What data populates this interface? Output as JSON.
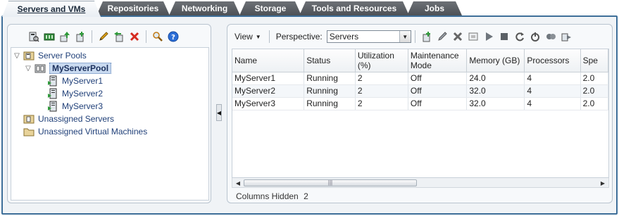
{
  "tabs": [
    {
      "label": "Servers and VMs",
      "active": true
    },
    {
      "label": "Repositories",
      "active": false
    },
    {
      "label": "Networking",
      "active": false
    },
    {
      "label": "Storage",
      "active": false
    },
    {
      "label": "Tools and Resources",
      "active": false
    },
    {
      "label": "Jobs",
      "active": false
    }
  ],
  "left_toolbar": {
    "icons": [
      "discover-server-icon",
      "create-server-pool-icon",
      "upload-icon",
      "add-server-icon",
      "edit-icon",
      "move-icon",
      "delete-icon",
      "find-icon",
      "help-icon"
    ]
  },
  "tree": {
    "server_pools": "Server Pools",
    "pool": "MyServerPool",
    "servers": [
      "MyServer1",
      "MyServer2",
      "MyServer3"
    ],
    "unassigned_servers": "Unassigned Servers",
    "unassigned_vms": "Unassigned Virtual Machines"
  },
  "right_toolbar": {
    "view_label": "View",
    "perspective_label": "Perspective:",
    "perspective_value": "Servers",
    "icons": [
      "add-icon",
      "edit-icon",
      "delete-icon",
      "console-icon",
      "start-icon",
      "stop-icon",
      "restart-icon",
      "power-icon",
      "kill-icon",
      "migrate-icon"
    ]
  },
  "table": {
    "columns": [
      "Name",
      "Status",
      "Utilization (%)",
      "Maintenance Mode",
      "Memory (GB)",
      "Processors",
      "Spe"
    ],
    "rows": [
      [
        "MyServer1",
        "Running",
        "2",
        "Off",
        "24.0",
        "4",
        "2.0"
      ],
      [
        "MyServer2",
        "Running",
        "2",
        "Off",
        "32.0",
        "4",
        "2.0"
      ],
      [
        "MyServer3",
        "Running",
        "2",
        "Off",
        "32.0",
        "4",
        "2.0"
      ]
    ]
  },
  "columns_hidden": {
    "label": "Columns Hidden",
    "count": "2"
  },
  "colors": {
    "accent": "#3e6f99",
    "tab_dark": "#5a5e63",
    "tree_text": "#1f3f78",
    "delete_red": "#d52a1f"
  }
}
